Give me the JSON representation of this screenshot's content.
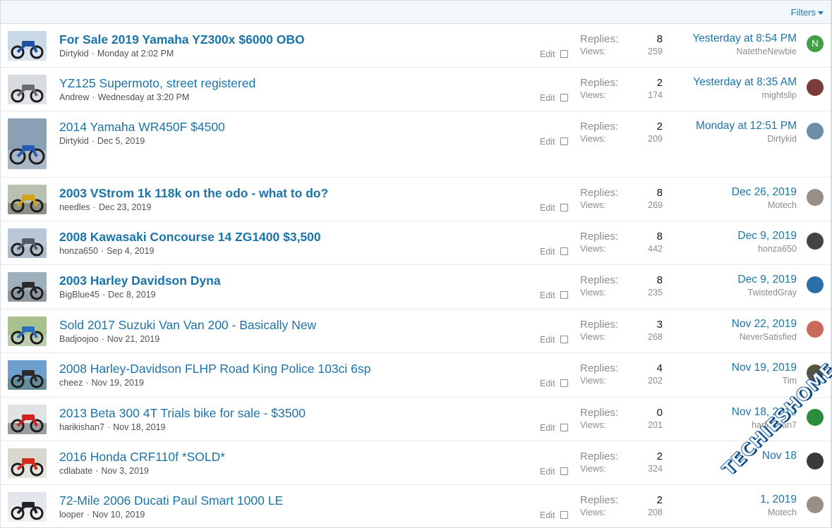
{
  "filters": {
    "label": "Filters"
  },
  "labels": {
    "replies": "Replies:",
    "views": "Views:",
    "edit": "Edit",
    "sep": "·"
  },
  "colors": {
    "link": "#1b74a8",
    "muted": "#8c8c8c"
  },
  "threads": [
    {
      "title": "For Sale 2019 Yamaha YZ300x $6000 OBO",
      "bold": true,
      "author": "Dirtykid",
      "date": "Monday at 2:02 PM",
      "replies": "8",
      "views": "259",
      "last_date": "Yesterday at 8:54 PM",
      "last_user": "NatetheNewbie",
      "avatar_letter": "N",
      "avatar_color": "#43a047",
      "thumb": "dirtbike-blue-icon"
    },
    {
      "title": "YZ125 Supermoto, street registered",
      "bold": false,
      "author": "Andrew",
      "date": "Wednesday at 3:20 PM",
      "replies": "2",
      "views": "174",
      "last_date": "Yesterday at 8:35 AM",
      "last_user": "mightslip",
      "avatar_letter": "",
      "avatar_color": "#7a3b3b",
      "thumb": "supermoto-icon"
    },
    {
      "title": "2014 Yamaha WR450F $4500",
      "bold": false,
      "author": "Dirtykid",
      "date": "Dec 5, 2019",
      "replies": "2",
      "views": "209",
      "last_date": "Monday at 12:51 PM",
      "last_user": "Dirtykid",
      "avatar_letter": "",
      "avatar_color": "#6f8fa8",
      "thumb": "dirtbike-icon"
    },
    {
      "title": "2003 VStrom 1k 118k on the odo - what to do?",
      "bold": true,
      "author": "needles",
      "date": "Dec 23, 2019",
      "replies": "8",
      "views": "269",
      "last_date": "Dec 26, 2019",
      "last_user": "Motech",
      "avatar_letter": "",
      "avatar_color": "#9a8f86",
      "thumb": "adventure-bike-icon"
    },
    {
      "title": "2008 Kawasaki Concourse 14 ZG1400 $3,500",
      "bold": true,
      "author": "honza650",
      "date": "Sep 4, 2019",
      "replies": "8",
      "views": "442",
      "last_date": "Dec 9, 2019",
      "last_user": "honza650",
      "avatar_letter": "",
      "avatar_color": "#444444",
      "thumb": "touring-bike-icon"
    },
    {
      "title": "2003 Harley Davidson Dyna",
      "bold": true,
      "author": "BigBlue45",
      "date": "Dec 8, 2019",
      "replies": "8",
      "views": "235",
      "last_date": "Dec 9, 2019",
      "last_user": "TwistedGray",
      "avatar_letter": "",
      "avatar_color": "#2a6fa8",
      "thumb": "cruiser-icon"
    },
    {
      "title": "Sold 2017 Suzuki Van Van 200 - Basically New",
      "bold": false,
      "author": "Badjoojoo",
      "date": "Nov 21, 2019",
      "replies": "3",
      "views": "268",
      "last_date": "Nov 22, 2019",
      "last_user": "NeverSatisfied",
      "avatar_letter": "",
      "avatar_color": "#c96b5a",
      "thumb": "vanvan-icon"
    },
    {
      "title": "2008 Harley-Davidson FLHP Road King Police 103ci 6sp",
      "bold": false,
      "author": "cheez",
      "date": "Nov 19, 2019",
      "replies": "4",
      "views": "202",
      "last_date": "Nov 19, 2019",
      "last_user": "Tim",
      "avatar_letter": "",
      "avatar_color": "#5a5240",
      "thumb": "road-king-icon"
    },
    {
      "title": "2013 Beta 300 4T Trials bike for sale - $3500",
      "bold": false,
      "author": "harikishan7",
      "date": "Nov 18, 2019",
      "replies": "0",
      "views": "201",
      "last_date": "Nov 18, 2019",
      "last_user": "harikishan7",
      "avatar_letter": "",
      "avatar_color": "#2e8b3a",
      "thumb": "trials-bike-icon"
    },
    {
      "title": "2016 Honda CRF110f *SOLD*",
      "bold": false,
      "author": "cdlabate",
      "date": "Nov 3, 2019",
      "replies": "2",
      "views": "324",
      "last_date": "Nov 18",
      "last_user": "",
      "avatar_letter": "",
      "avatar_color": "#3a3a3a",
      "thumb": "pitbike-icon"
    },
    {
      "title": "72-Mile 2006 Ducati Paul Smart 1000 LE",
      "bold": false,
      "author": "looper",
      "date": "Nov 10, 2019",
      "replies": "2",
      "views": "208",
      "last_date": "1, 2019",
      "last_user": "Motech",
      "avatar_letter": "",
      "avatar_color": "#9a8f86",
      "thumb": "ducati-icon"
    }
  ],
  "watermark": {
    "text": "TECHIESHOME.COM"
  }
}
